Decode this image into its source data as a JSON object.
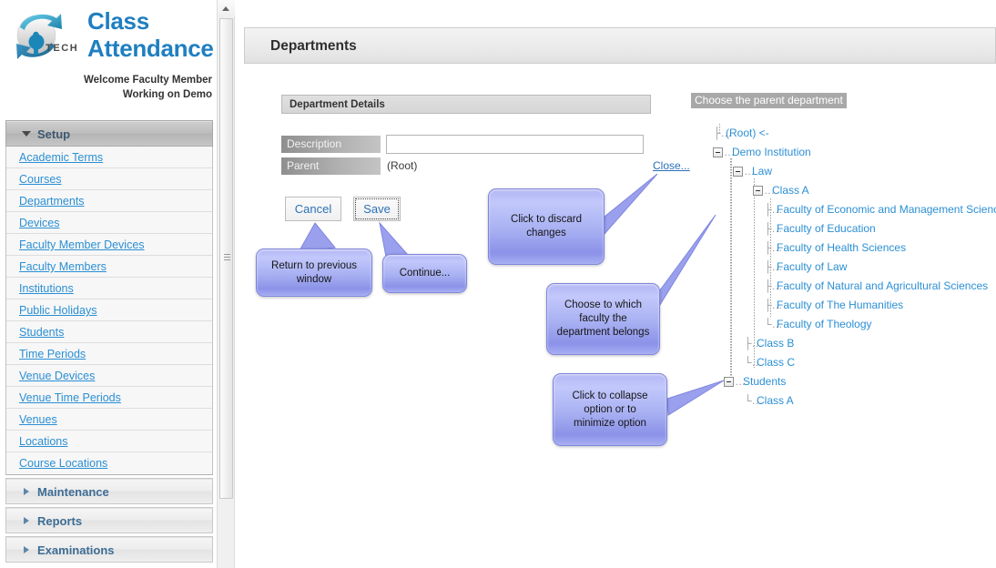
{
  "app": {
    "brand_line1": "Class",
    "brand_line2": "Attendance",
    "logo_text": "iTECH",
    "welcome_line1": "Welcome Faculty Member",
    "welcome_line2": "Working on Demo"
  },
  "sidebar": {
    "sections": [
      {
        "label": "Setup",
        "expanded": true
      },
      {
        "label": "Maintenance",
        "expanded": false
      },
      {
        "label": "Reports",
        "expanded": false
      },
      {
        "label": "Examinations",
        "expanded": false
      }
    ],
    "items": [
      {
        "label": "Academic Terms"
      },
      {
        "label": "Courses"
      },
      {
        "label": "Departments"
      },
      {
        "label": "Devices"
      },
      {
        "label": "Faculty Member Devices"
      },
      {
        "label": "Faculty Members"
      },
      {
        "label": "Institutions"
      },
      {
        "label": "Public Holidays"
      },
      {
        "label": "Students"
      },
      {
        "label": "Time Periods"
      },
      {
        "label": "Venue Devices"
      },
      {
        "label": "Venue Time Periods"
      },
      {
        "label": "Venues"
      },
      {
        "label": "Locations"
      },
      {
        "label": "Course Locations"
      }
    ]
  },
  "main": {
    "page_title": "Departments",
    "details_header": "Department Details",
    "fields": {
      "description_label": "Description",
      "description_value": "",
      "description_placeholder": "",
      "parent_label": "Parent",
      "parent_value": "(Root)"
    },
    "close_link": "Close...",
    "buttons": {
      "cancel": "Cancel",
      "save": "Save"
    }
  },
  "tree": {
    "title": "Choose the parent department",
    "nodes": [
      {
        "label": "(Root) <-",
        "depth": 0,
        "toggle": false
      },
      {
        "label": "Demo Institution",
        "depth": 0,
        "toggle": true
      },
      {
        "label": "Law",
        "depth": 1,
        "toggle": true
      },
      {
        "label": "Class A",
        "depth": 2,
        "toggle": true
      },
      {
        "label": "Faculty of Economic and Management Sciences",
        "depth": 3,
        "toggle": false
      },
      {
        "label": "Faculty of Education",
        "depth": 3,
        "toggle": false
      },
      {
        "label": "Faculty of Health Sciences",
        "depth": 3,
        "toggle": false
      },
      {
        "label": "Faculty of Law",
        "depth": 3,
        "toggle": false
      },
      {
        "label": "Faculty of Natural and Agricultural Sciences",
        "depth": 3,
        "toggle": false
      },
      {
        "label": "Faculty of The Humanities",
        "depth": 3,
        "toggle": false
      },
      {
        "label": "Faculty of Theology",
        "depth": 3,
        "toggle": false
      },
      {
        "label": "Class B",
        "depth": 2,
        "toggle": false
      },
      {
        "label": "Class C",
        "depth": 2,
        "toggle": false
      },
      {
        "label": "Students",
        "depth": 0,
        "toggle": true
      },
      {
        "label": "Class A",
        "depth": 1,
        "toggle": false
      }
    ]
  },
  "callouts": [
    {
      "id": "return-previous",
      "text": "Return to previous\nwindow"
    },
    {
      "id": "continue",
      "text": "Continue..."
    },
    {
      "id": "discard-changes",
      "text": "Click to discard\nchanges"
    },
    {
      "id": "choose-faculty",
      "text": "Choose to which\nfaculty the\ndepartment belongs"
    },
    {
      "id": "collapse-option",
      "text": "Click to collapse\noption or to\nminimize option"
    }
  ],
  "colors": {
    "brand_blue": "#1f7fc0",
    "link_blue": "#2b8fd4",
    "callout_fill": "#a8b0f2",
    "callout_border": "#7f86dd"
  }
}
